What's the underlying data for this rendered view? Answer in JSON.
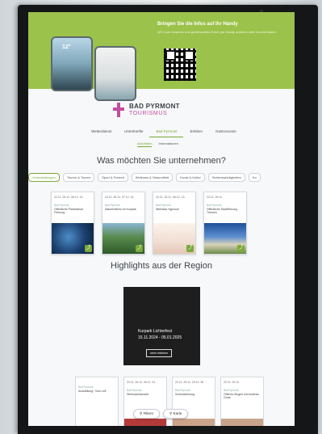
{
  "banner": {
    "title": "Bringen Sie die Infos auf Ihr Handy",
    "subtitle": "QR Code scannen und gewünschtes Event per Handy aufrufen oder herunterladen",
    "phone_temp": "12°"
  },
  "brand": {
    "line1": "BAD PYRMONT",
    "line2": "TOURISMUS"
  },
  "main_nav": [
    "Wetterdienst",
    "Unterkünfte",
    "Bad Pyrmont",
    "Erleben",
    "Gastronomie"
  ],
  "main_nav_active": "Bad Pyrmont",
  "sub_nav": [
    "Aktivitäten",
    "Informationen"
  ],
  "sub_nav_active": "Aktivitäten",
  "question_heading": "Was möchten Sie unternehmen?",
  "categories": [
    "Veranstaltungen",
    "Touren & Touren",
    "Sport & Freizeit",
    "Wellness & Gesundheit",
    "Kunst & Kultur",
    "Sehenswürdigkeiten",
    "Ko"
  ],
  "categories_active": "Veranstaltungen",
  "event_cards": [
    {
      "date": "22.11. 29.11. 06.12. 13.",
      "location": "Bad Pyrmont",
      "title": "Öffentliche Planetarium Führung"
    },
    {
      "date": "23.11. 30.11. 07.12. 14.",
      "location": "Bad Pyrmont",
      "title": "Naturerlebnis im Kurpark"
    },
    {
      "date": "22.11. 23.11. 06.12. 13.",
      "location": "Bad Pyrmont",
      "title": "Wellness Hypnose"
    },
    {
      "date": "22.11. 29.11.",
      "location": "Bad Pyrmont",
      "title": "Öffentliche Stadtführung - Themen"
    }
  ],
  "highlights_heading": "Highlights aus der Region",
  "highlight": {
    "label": "Kurpark Lichterfest",
    "dates": "15.11.2024 - 05.01.2025",
    "button": "mehr erfahren"
  },
  "bottom_cards": [
    {
      "date": "",
      "location": "Bad Pyrmont",
      "title": "Ausstellung: 'Vom Leit'"
    },
    {
      "date": "23.11. 24.11. 30.11. 01.",
      "location": "Bad Pyrmont",
      "title": "Weihnachtsmarkt"
    },
    {
      "date": "22.11. 23.11. 29.11. 30.",
      "location": "Bad Pyrmont",
      "title": "Schlossführung"
    },
    {
      "date": "22.11. 29.11.",
      "location": "Bad Pyrmont",
      "title": "Offenes Singen mit Andreas Grote"
    }
  ],
  "float_buttons": {
    "filter": "Filtern",
    "map": "Karte"
  },
  "colors": {
    "accent": "#7aa93a",
    "banner": "#9bc24a",
    "brand_pink": "#c44da0"
  }
}
